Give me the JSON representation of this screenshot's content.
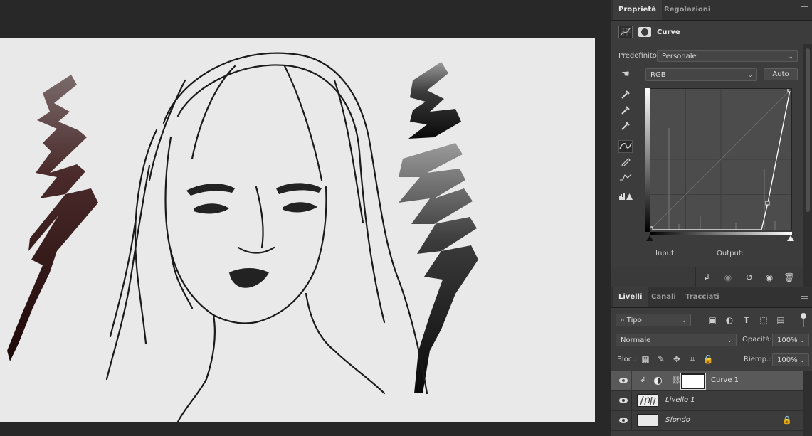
{
  "properties_panel": {
    "tabs": [
      "Proprietà",
      "Regolazioni"
    ],
    "active_tab": "Proprietà",
    "adjustment_title": "Curve",
    "preset_label": "Predefinito:",
    "preset_value": "Personale",
    "channel_value": "RGB",
    "auto_button": "Auto",
    "input_label": "Input:",
    "output_label": "Output:"
  },
  "layers_panel": {
    "tabs": [
      "Livelli",
      "Canali",
      "Tracciati"
    ],
    "active_tab": "Livelli",
    "filter_value": "Tipo",
    "blend_mode": "Normale",
    "opacity_label": "Opacità:",
    "opacity_value": "100%",
    "lock_label": "Bloc.:",
    "fill_label": "Riemp.:",
    "fill_value": "100%",
    "layers": [
      {
        "name": "Curve 1"
      },
      {
        "name": "Livello 1"
      },
      {
        "name": "Sfondo"
      }
    ]
  },
  "colors": {
    "ui_background": "#3c3c3c",
    "canvas_background": "#e9e9e9",
    "selected_layer": "#595959"
  }
}
